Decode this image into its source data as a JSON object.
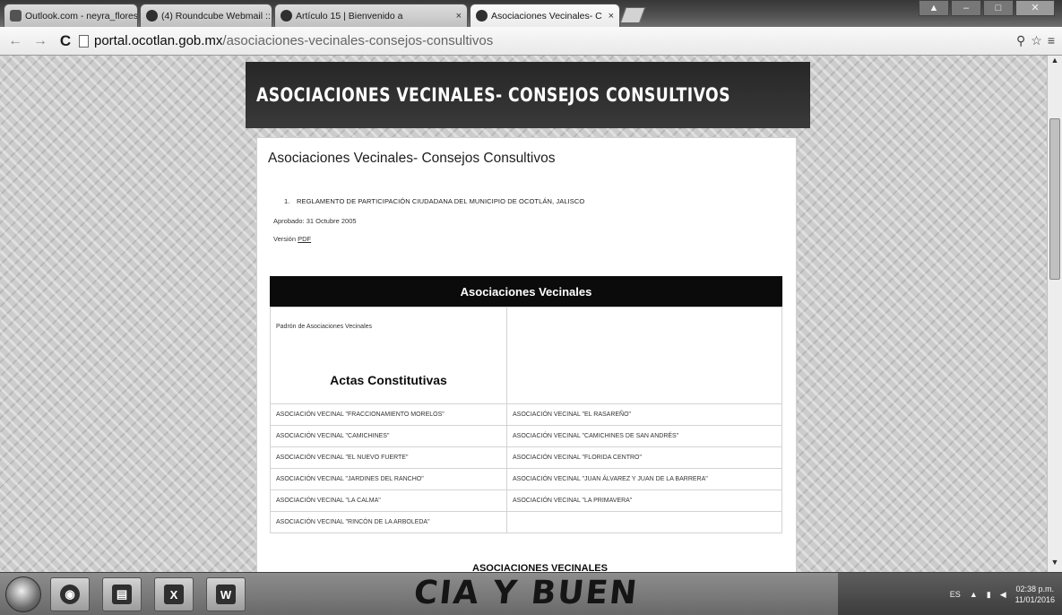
{
  "browser": {
    "tabs": [
      {
        "label": "Outlook.com - neyra_flores94",
        "active": false
      },
      {
        "label": "(4) Roundcube Webmail ::",
        "active": false
      },
      {
        "label": "Artículo 15 | Bienvenido a",
        "active": false
      },
      {
        "label": "Asociaciones Vecinales- C",
        "active": true
      }
    ],
    "url_domain": "portal.ocotlan.gob.mx",
    "url_path": "/asociaciones-vecinales-consejos-consultivos"
  },
  "page": {
    "banner_title": "ASOCIACIONES VECINALES- CONSEJOS CONSULTIVOS",
    "content_title": "Asociaciones Vecinales- Consejos Consultivos",
    "reglamento_number": "1.",
    "reglamento": "REGLAMENTO DE PARTICIPACIÓN CIUDADANA DEL MUNICIPIO DE OCOTLÁN, JALISCO",
    "aprobado": "Aprobado: 31 Octubre 2005",
    "version_label": "Versión",
    "version_link": "PDF",
    "section_header": "Asociaciones Vecinales",
    "padron": "Padrón de Asociaciones Vecinales",
    "actas_title": "Actas Constitutivas",
    "asociaciones": [
      [
        "ASOCIACIÓN VECINAL \"FRACCIONAMIENTO MORELOS\"",
        "ASOCIACIÓN VECINAL \"EL RASAREÑO\""
      ],
      [
        "ASOCIACIÓN VECINAL \"CAMICHINES\"",
        "ASOCIACIÓN VECINAL \"CAMICHINES DE SAN ANDRÉS\""
      ],
      [
        "ASOCIACIÓN VECINAL \"EL NUEVO FUERTE\"",
        "ASOCIACIÓN VECINAL \"FLORIDA CENTRO\""
      ],
      [
        "ASOCIACIÓN VECINAL \"JARDINES DEL RANCHO\"",
        "ASOCIACIÓN VECINAL \"JUAN ÁLVAREZ Y JUAN DE LA BARRERA\""
      ],
      [
        "ASOCIACIÓN VECINAL \"LA CALMA\"",
        "ASOCIACIÓN VECINAL \"LA PRIMAVERA\""
      ],
      [
        "ASOCIACIÓN VECINAL \"RINCÓN DE LA ARBOLEDA\"",
        ""
      ]
    ],
    "footer_link": "ASOCIACIONES VECINALES"
  },
  "taskbar": {
    "background_text": "CIA Y BUEN",
    "language": "ES",
    "time": "02:38 p.m.",
    "date": "11/01/2016"
  }
}
